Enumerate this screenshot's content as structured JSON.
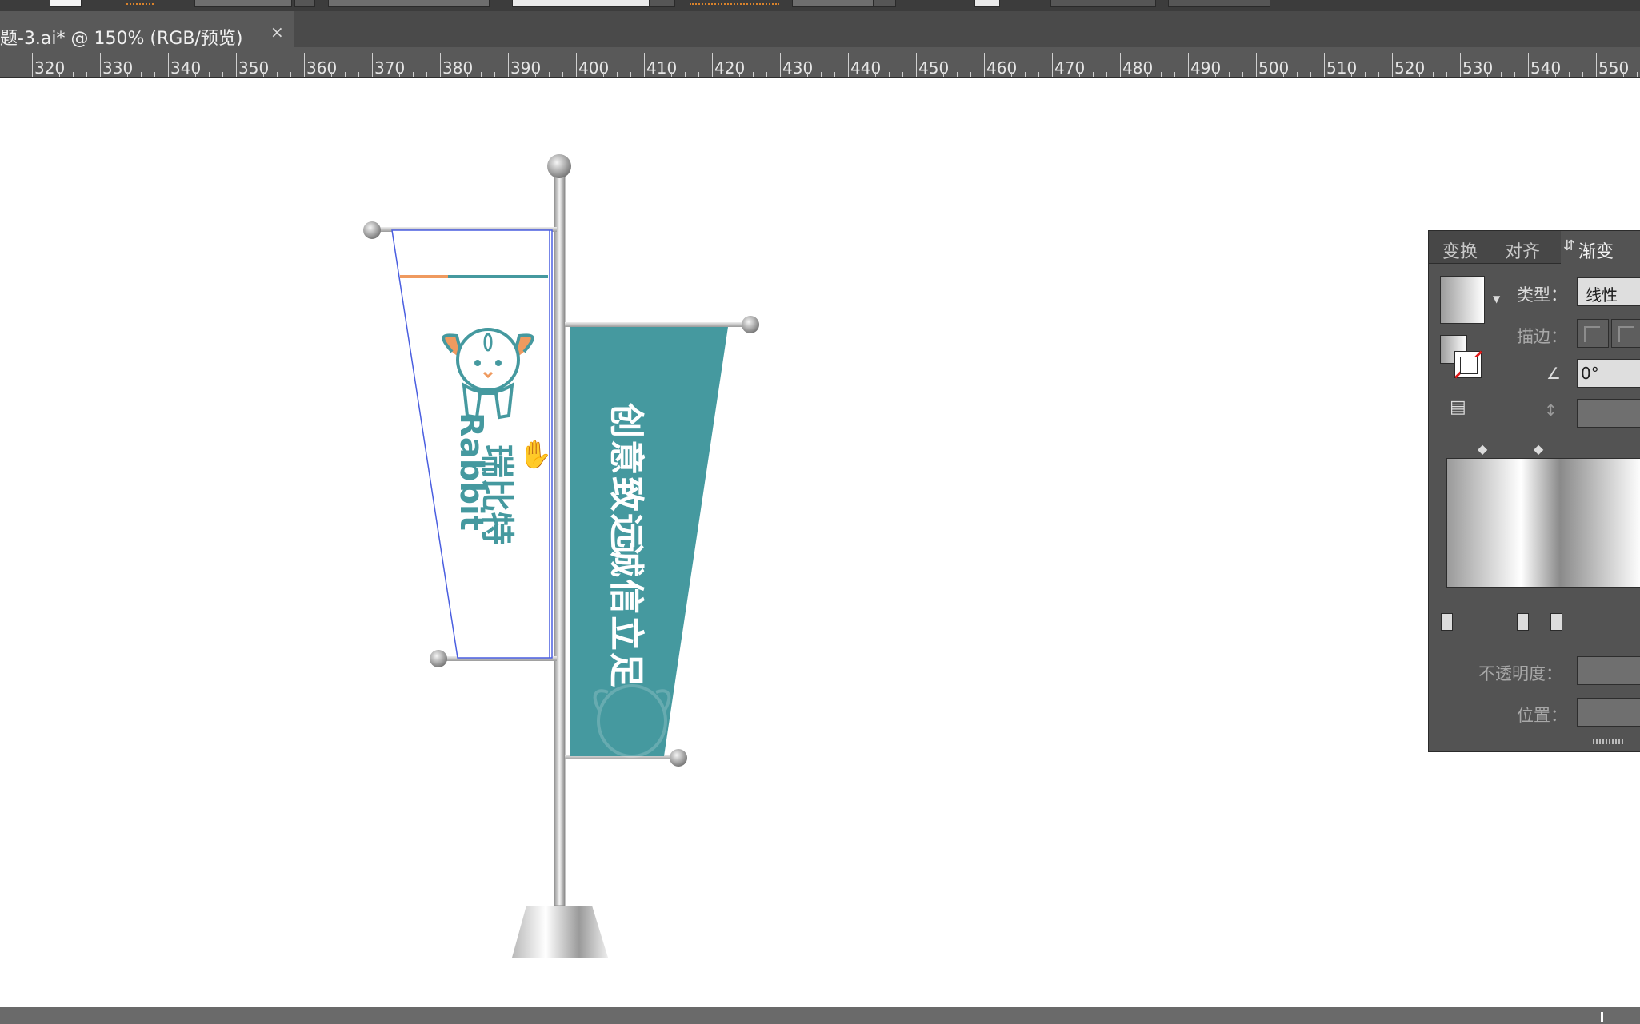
{
  "document_tab": {
    "title": "题-3.ai* @ 150% (RGB/预览)",
    "close": "×"
  },
  "ruler": {
    "labels": [
      "320",
      "330",
      "340",
      "350",
      "360",
      "370",
      "380",
      "390",
      "400",
      "410",
      "420",
      "430",
      "440",
      "450",
      "460",
      "470",
      "480",
      "490",
      "500",
      "510",
      "520",
      "530",
      "540",
      "550"
    ]
  },
  "artwork": {
    "flag_left_brand_cn": "瑞比特",
    "flag_left_brand_en": "Rabbit",
    "flag_right_text": "创意致远 诚信立足",
    "flag_right_line1": "创意致远",
    "flag_right_line2": "诚信立足",
    "colors": {
      "teal": "#45999f",
      "orange": "#ef9a5f",
      "selection": "#4a5ee0"
    }
  },
  "gradient_panel": {
    "tabs": [
      "变换",
      "对齐",
      "渐变"
    ],
    "active_tab": "渐变",
    "type_label": "类型：",
    "type_value": "线性",
    "stroke_label": "描边：",
    "angle_value": "0°",
    "opacity_label": "不透明度：",
    "position_label": "位置："
  },
  "icons": {
    "gradient_swatch": "gradient-swatch-icon",
    "fill_stroke": "fill-stroke-icon",
    "reverse": "reverse-gradient-icon",
    "angle": "angle-icon",
    "aspect": "aspect-ratio-icon",
    "cursor": "hand-cursor-icon"
  }
}
